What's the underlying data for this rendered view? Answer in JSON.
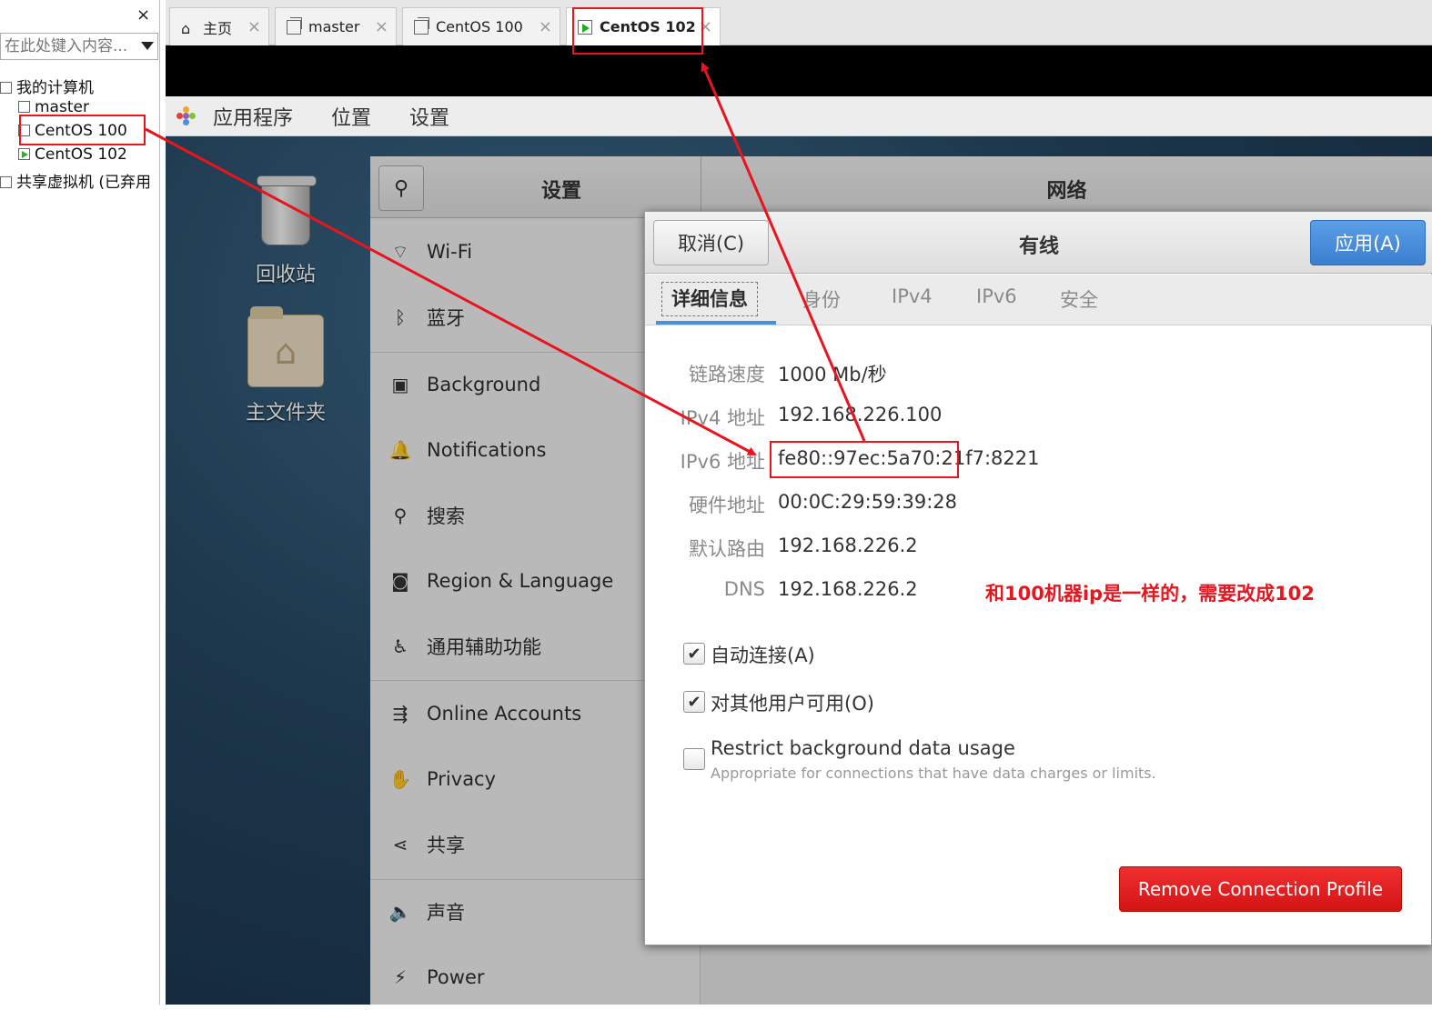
{
  "library": {
    "close_glyph": "×",
    "search_placeholder": "在此处键入内容...",
    "tree": [
      {
        "label": "我的计算机",
        "icon": "computer-icon"
      },
      {
        "label": "master",
        "icon": "vm-icon"
      },
      {
        "label": "CentOS 100",
        "icon": "vm-icon"
      },
      {
        "label": "CentOS 102",
        "icon": "vm-running-icon"
      },
      {
        "label": "共享虚拟机 (已弃用",
        "icon": "shared-vm-icon"
      }
    ]
  },
  "tabs": [
    {
      "label": "主页",
      "icon": "home-icon",
      "active": false
    },
    {
      "label": "master",
      "icon": "vm-icon",
      "active": false
    },
    {
      "label": "CentOS 100",
      "icon": "vm-icon",
      "active": false
    },
    {
      "label": "CentOS 102",
      "icon": "vm-running-icon",
      "active": true
    }
  ],
  "tab_close_glyph": "×",
  "gnome_bar": {
    "applications": "应用程序",
    "places": "位置",
    "settings": "设置"
  },
  "desktop": {
    "trash_label": "回收站",
    "home_label": "主文件夹"
  },
  "settings_window": {
    "left_title": "设置",
    "right_title": "网络",
    "sidebar": [
      {
        "label": "Wi-Fi",
        "icon": "wifi-icon",
        "glyph": "⌔"
      },
      {
        "label": "蓝牙",
        "icon": "bluetooth-icon",
        "glyph": "ᛒ"
      },
      {
        "label": "Background",
        "icon": "background-icon",
        "glyph": "▣"
      },
      {
        "label": "Notifications",
        "icon": "bell-icon",
        "glyph": "🔔"
      },
      {
        "label": "搜索",
        "icon": "search-icon",
        "glyph": "⚲"
      },
      {
        "label": "Region & Language",
        "icon": "camera-icon",
        "glyph": "◙"
      },
      {
        "label": "通用辅助功能",
        "icon": "accessibility-icon",
        "glyph": "♿"
      },
      {
        "label": "Online Accounts",
        "icon": "online-accounts-icon",
        "glyph": "⇶"
      },
      {
        "label": "Privacy",
        "icon": "hand-icon",
        "glyph": "✋"
      },
      {
        "label": "共享",
        "icon": "share-icon",
        "glyph": "⋖"
      },
      {
        "label": "声音",
        "icon": "speaker-icon",
        "glyph": "🔈"
      },
      {
        "label": "Power",
        "icon": "power-icon",
        "glyph": "⚡"
      }
    ]
  },
  "dialog": {
    "cancel_label": "取消(C)",
    "title": "有线",
    "apply_label": "应用(A)",
    "tabs": [
      "详细信息",
      "身份",
      "IPv4",
      "IPv6",
      "安全"
    ],
    "details": [
      {
        "label": "链路速度",
        "value": "1000 Mb/秒"
      },
      {
        "label": "IPv4 地址",
        "value": "192.168.226.100"
      },
      {
        "label": "IPv6 地址",
        "value": "fe80::97ec:5a70:21f7:8221"
      },
      {
        "label": "硬件地址",
        "value": "00:0C:29:59:39:28"
      },
      {
        "label": "默认路由",
        "value": "192.168.226.2"
      },
      {
        "label": "DNS",
        "value": "192.168.226.2"
      }
    ],
    "auto_connect": {
      "label": "自动连接(A)",
      "checked": true
    },
    "other_users": {
      "label": "对其他用户可用(O)",
      "checked": true
    },
    "restrict_bg": {
      "label": "Restrict background data usage",
      "sublabel": "Appropriate for connections that have data charges or limits.",
      "checked": false
    },
    "remove_label": "Remove Connection Profile"
  },
  "annotation_text": "和100机器ip是一样的，需要改成102",
  "colors": {
    "annotation_red": "#e8141e",
    "apply_blue": "#3a7fcf",
    "remove_red": "#d41414"
  }
}
